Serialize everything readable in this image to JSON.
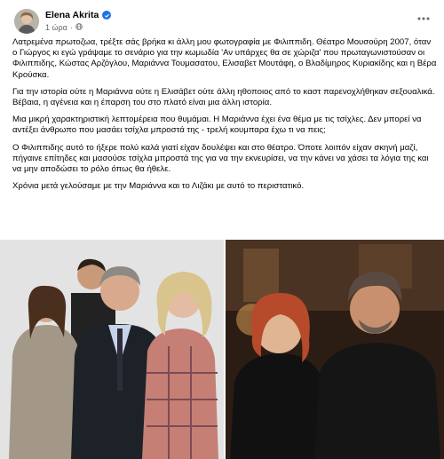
{
  "post": {
    "author": "Elena Akrita",
    "time": "1 ώρα",
    "meta_sep": "·",
    "paragraphs": [
      "Λατρεμένα πρωτοζωα, τρέξτε σάς βρήκα κι άλλη μου φωτογραφία με Φιλιππιδη. Θέατρο Μουσούρη 2007, όταν ο Γιώργος κι εγώ γράψαμε το σενάριο για την κωμωδία 'Αν υπάρχες θα σε χώριζα' που πρωταγωνιστούσαν οι Φιλιππιδης, Κώστας Αρζόγλου, Μαριάννα Τουμασατου, Ελισαβετ Μουτάφη, ο Βλαδίμηρος Κυριακίδης και η Βέρα Κρούσκα.",
      "Για την ιστορία ούτε η Μαριάννα ούτε η Ελισάβετ ούτε άλλη ηθοποιος από το καστ παρενοχλήθηκαν σεξουαλικά. Βέβαια, η αγένεια και η έπαρση του στο πλατό είναι μια άλλη ιστορία.",
      "Μια μικρή χαρακτηριστική λεπτομέρεια που θυμάμαι. Η Μαριάννα έχει ένα θέμα με τις τσίχλες. Δεν μπορεί να αντέξει άνθρωπο που μασάει τσίχλα μπροστά της - τρελή κουμπαρα έχω τι να πεις;",
      "Ο Φιλιππιδης αυτό το ήξερε πολύ καλά γιατί είχαν δουλέψει και στο θέατρο. Όποτε λοιπόν είχαν σκηνή μαζί, πήγαινε επίτηδες και μασούσε τσίχλα μπροστά της για να την εκνευρίσει, να την κάνει να χάσει τα λόγια της και να μην αποδώσει το ρόλο όπως θα ήθελε.",
      "Χρόνια μετά γελούσαμε με την Μαριάννα και το Λιζάκι με αυτό το περιστατικό."
    ]
  },
  "icons": {
    "verified": "verified-badge-icon",
    "globe": "globe-icon",
    "more": "more-options-icon"
  },
  "colors": {
    "verified_blue": "#1b74e4",
    "meta_gray": "#65676b",
    "text": "#050505"
  }
}
